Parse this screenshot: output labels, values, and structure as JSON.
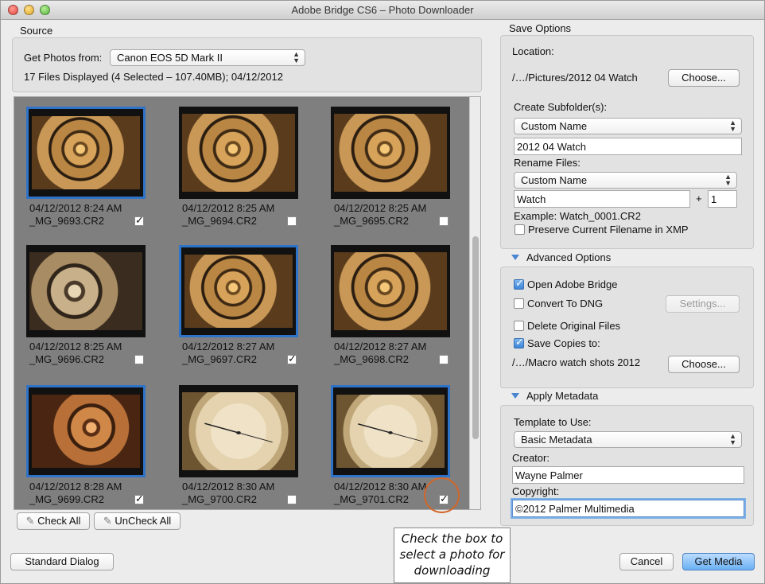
{
  "window": {
    "title": "Adobe Bridge CS6 – Photo Downloader"
  },
  "source": {
    "label": "Source",
    "get_photos_label": "Get Photos from:",
    "device": "Canon EOS 5D Mark II",
    "summary": "17 Files Displayed (4 Selected – 107.40MB); 04/12/2012"
  },
  "photos": [
    {
      "datetime": "04/12/2012 8:24 AM",
      "filename": "_MG_9693.CR2",
      "checked": true,
      "tone": "gold"
    },
    {
      "datetime": "04/12/2012 8:25 AM",
      "filename": "_MG_9694.CR2",
      "checked": false,
      "tone": "gold"
    },
    {
      "datetime": "04/12/2012 8:25 AM",
      "filename": "_MG_9695.CR2",
      "checked": false,
      "tone": "gold"
    },
    {
      "datetime": "04/12/2012 8:25 AM",
      "filename": "_MG_9696.CR2",
      "checked": false,
      "tone": "steel"
    },
    {
      "datetime": "04/12/2012 8:27 AM",
      "filename": "_MG_9697.CR2",
      "checked": true,
      "tone": "gold"
    },
    {
      "datetime": "04/12/2012 8:27 AM",
      "filename": "_MG_9698.CR2",
      "checked": false,
      "tone": "gold"
    },
    {
      "datetime": "04/12/2012 8:28 AM",
      "filename": "_MG_9699.CR2",
      "checked": true,
      "tone": "copper"
    },
    {
      "datetime": "04/12/2012 8:30 AM",
      "filename": "_MG_9700.CR2",
      "checked": false,
      "tone": "dial"
    },
    {
      "datetime": "04/12/2012 8:30 AM",
      "filename": "_MG_9701.CR2",
      "checked": true,
      "tone": "dial"
    }
  ],
  "grid_buttons": {
    "check_all": "Check All",
    "uncheck_all": "UnCheck All"
  },
  "save_options": {
    "label": "Save Options",
    "location_label": "Location:",
    "location_path": "/…/Pictures/2012 04 Watch",
    "choose": "Choose...",
    "subfolder_label": "Create Subfolder(s):",
    "subfolder_mode": "Custom Name",
    "subfolder_name": "2012 04 Watch",
    "rename_label": "Rename Files:",
    "rename_mode": "Custom Name",
    "rename_base": "Watch",
    "plus": "+",
    "rename_start": "1",
    "example": "Example:  Watch_0001.CR2",
    "preserve_label": "Preserve Current Filename in XMP"
  },
  "advanced": {
    "label": "Advanced Options",
    "open_bridge": "Open Adobe Bridge",
    "convert_dng": "Convert To DNG",
    "settings": "Settings...",
    "delete_originals": "Delete Original Files",
    "save_copies": "Save Copies to:",
    "copies_path": "/…/Macro watch shots 2012",
    "choose": "Choose..."
  },
  "metadata": {
    "label": "Apply Metadata",
    "template_label": "Template to Use:",
    "template": "Basic Metadata",
    "creator_label": "Creator:",
    "creator": "Wayne Palmer",
    "copyright_label": "Copyright:",
    "copyright": "©2012 Palmer Multimedia"
  },
  "footer": {
    "standard_dialog": "Standard Dialog",
    "cancel": "Cancel",
    "get_media": "Get Media"
  },
  "callout": {
    "line1": "Check the box to",
    "line2": "select a photo for",
    "line3": "downloading"
  },
  "colors": {
    "accent": "#2f73c9",
    "callout_circle": "#d2672b"
  }
}
